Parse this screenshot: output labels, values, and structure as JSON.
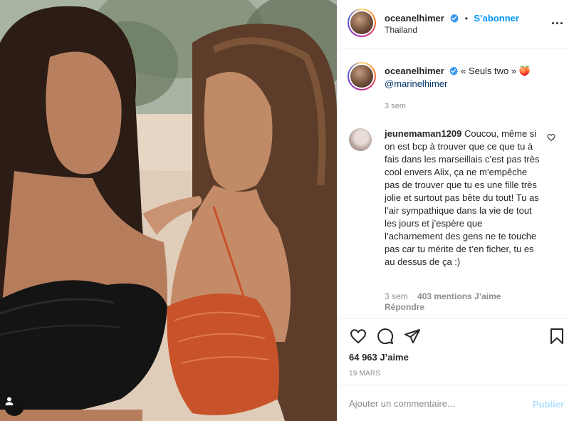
{
  "post": {
    "username": "oceanelhimer",
    "follow_separator": "•",
    "follow_label": "S’abonner",
    "location": "Thailand",
    "more_label": "..."
  },
  "caption": {
    "username": "oceanelhimer",
    "text": "« Seuls two »",
    "emoji": "🍑",
    "mention": "@marinelhimer",
    "time": "3 sem"
  },
  "comments": [
    {
      "username": "jeunemaman1209",
      "text": "Coucou, même si on est bcp à trouver que ce que tu à fais dans les marseillais c’est pas très cool envers Alix, ça ne m’empêche pas de trouver que tu es une fille très jolie et surtout pas bête du tout! Tu as l’air sympathique dans la vie de tout les jours et j’espère que l’acharnement des gens ne te touche pas car tu mérite de t’en ficher, tu es au dessus de ça :)",
      "time": "3 sem",
      "likes": "403 mentions J’aime",
      "reply_label": "Répondre"
    }
  ],
  "stats": {
    "likes": "64 963 J’aime",
    "date": "19 MARS"
  },
  "comment_input": {
    "placeholder": "Ajouter un commentaire...",
    "value": "",
    "submit_label": "Publier"
  },
  "colors": {
    "accent": "#0095f6",
    "text": "#262626",
    "muted": "#8e8e8e",
    "border": "#efefef",
    "publish_disabled": "#b2dffc"
  }
}
